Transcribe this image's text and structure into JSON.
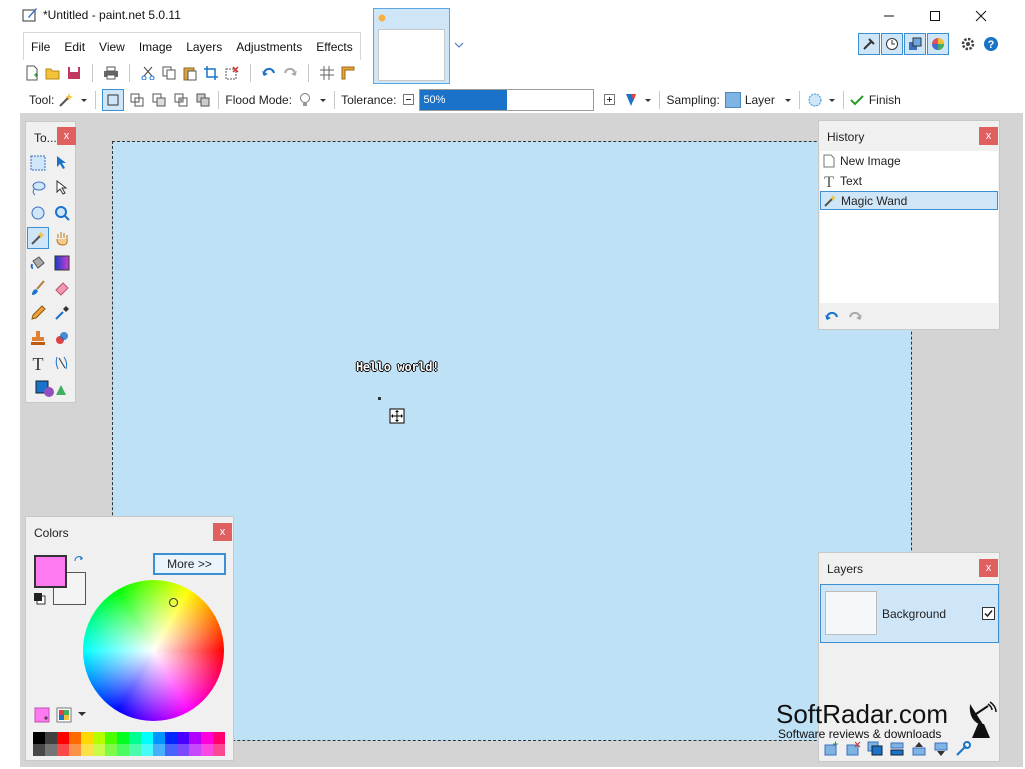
{
  "window": {
    "title": "*Untitled - paint.net 5.0.11",
    "minimize_icon": "minimize-icon",
    "maximize_icon": "maximize-icon",
    "close_icon": "close-icon"
  },
  "menu": {
    "items": [
      "File",
      "Edit",
      "View",
      "Image",
      "Layers",
      "Adjustments",
      "Effects"
    ]
  },
  "toolbar": {
    "tool_label": "Tool:",
    "flood_mode_label": "Flood Mode:",
    "tolerance_label": "Tolerance:",
    "tolerance_value": "50%",
    "tolerance_fraction": 0.5,
    "sampling_label": "Sampling:",
    "sampling_value": "Layer",
    "finish_label": "Finish"
  },
  "canvas": {
    "text": "Hello world!",
    "background": "#bfe1f5"
  },
  "tools_panel": {
    "title": "To...",
    "close": "x"
  },
  "history_panel": {
    "title": "History",
    "close": "x",
    "items": [
      {
        "label": "New Image",
        "icon": "new-image-icon"
      },
      {
        "label": "Text",
        "icon": "text-icon"
      },
      {
        "label": "Magic Wand",
        "icon": "magic-wand-icon"
      }
    ]
  },
  "colors_panel": {
    "title": "Colors",
    "close": "x",
    "more_label": "More >>",
    "primary": "#ff7af0",
    "secondary": "#f4f4f4"
  },
  "layers_panel": {
    "title": "Layers",
    "close": "x",
    "layers": [
      {
        "name": "Background",
        "visible": true
      }
    ]
  },
  "watermark": {
    "brand": "SoftRadar.com",
    "tagline": "Software reviews & downloads"
  },
  "palette": [
    "#000000",
    "#404040",
    "#ff0000",
    "#ff6a00",
    "#ffd800",
    "#b6ff00",
    "#4cff00",
    "#00ff21",
    "#00ff90",
    "#00ffff",
    "#0094ff",
    "#0026ff",
    "#4800ff",
    "#b200ff",
    "#ff00dc",
    "#ff006e"
  ]
}
